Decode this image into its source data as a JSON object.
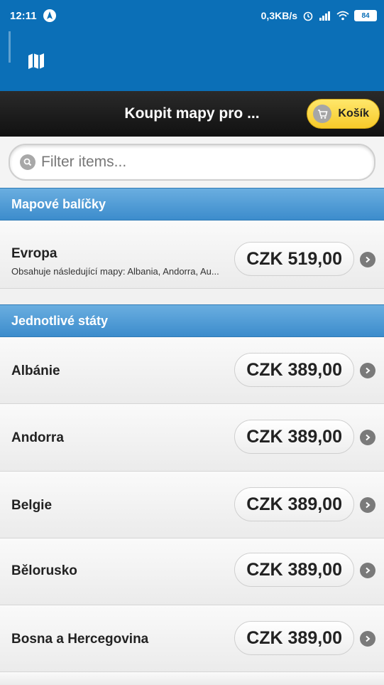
{
  "status_bar": {
    "time": "12:11",
    "network_speed": "0,3KB/s",
    "battery": "84"
  },
  "header": {
    "title": "Koupit mapy pro ...",
    "cart_label": "Košík"
  },
  "search": {
    "placeholder": "Filter items..."
  },
  "sections": [
    {
      "title": "Mapové balíčky",
      "items": [
        {
          "name": "Evropa",
          "description": "Obsahuje následující mapy: Albania, Andorra, Au...",
          "price": "CZK 519,00"
        }
      ]
    },
    {
      "title": "Jednotlivé státy",
      "items": [
        {
          "name": "Albánie",
          "price": "CZK 389,00"
        },
        {
          "name": "Andorra",
          "price": "CZK 389,00"
        },
        {
          "name": "Belgie",
          "price": "CZK 389,00"
        },
        {
          "name": "Bělorusko",
          "price": "CZK 389,00"
        },
        {
          "name": "Bosna a Hercegovina",
          "price": "CZK 389,00"
        }
      ]
    }
  ],
  "colors": {
    "app_bar": "#0b6fb7",
    "divider": "#4a98d4",
    "cart_button": "#f8d23a"
  },
  "icons": [
    "navigation-icon",
    "alarm-icon",
    "signal-icon",
    "wifi-icon",
    "battery-icon",
    "map-icon",
    "cart-icon",
    "search-icon",
    "chevron-right-icon"
  ]
}
